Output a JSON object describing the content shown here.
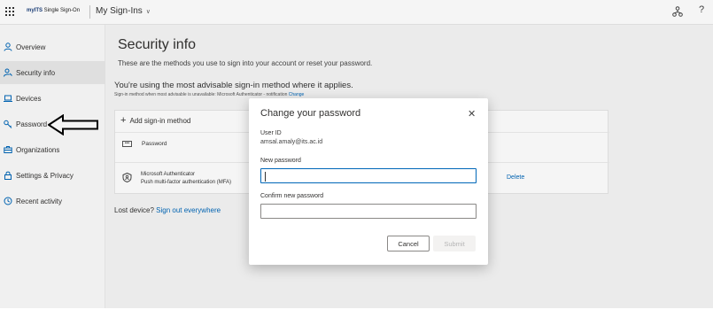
{
  "topbar": {
    "brand_bold": "myITS",
    "brand_rest": " Single Sign-On",
    "app_title": "My Sign-Ins",
    "help_label": "?"
  },
  "sidebar": {
    "items": [
      {
        "label": "Overview",
        "icon": "person-icon"
      },
      {
        "label": "Security info",
        "icon": "person-key-icon"
      },
      {
        "label": "Devices",
        "icon": "laptop-icon"
      },
      {
        "label": "Password",
        "icon": "key-icon"
      },
      {
        "label": "Organizations",
        "icon": "briefcase-icon"
      },
      {
        "label": "Settings & Privacy",
        "icon": "lock-icon"
      },
      {
        "label": "Recent activity",
        "icon": "history-icon"
      }
    ],
    "active_index": 1
  },
  "main": {
    "title": "Security info",
    "subtitle": "These are the methods you use to sign into your account or reset your password.",
    "advise": "You're using the most advisable sign-in method where it applies.",
    "advise_sub": "Sign-in method when most advisable is unavailable: Microsoft Authenticator - notification",
    "advise_link": "Change",
    "add_method": "Add sign-in method",
    "methods": [
      {
        "name": "Password",
        "icon": "password-dots-icon"
      },
      {
        "name": "Microsoft Authenticator",
        "detail": "Push multi-factor authentication (MFA)",
        "icon": "authenticator-icon",
        "action": "Delete"
      }
    ],
    "lost_device": "Lost device?",
    "lost_link": "Sign out everywhere"
  },
  "dialog": {
    "title": "Change your password",
    "user_id_label": "User ID",
    "user_id_value": "amsal.amaly@its.ac.id",
    "new_password_label": "New password",
    "new_password_value": "",
    "confirm_password_label": "Confirm new password",
    "confirm_password_value": "",
    "cancel_label": "Cancel",
    "submit_label": "Submit"
  },
  "colors": {
    "accent": "#0067b8",
    "link": "#0067b8"
  }
}
